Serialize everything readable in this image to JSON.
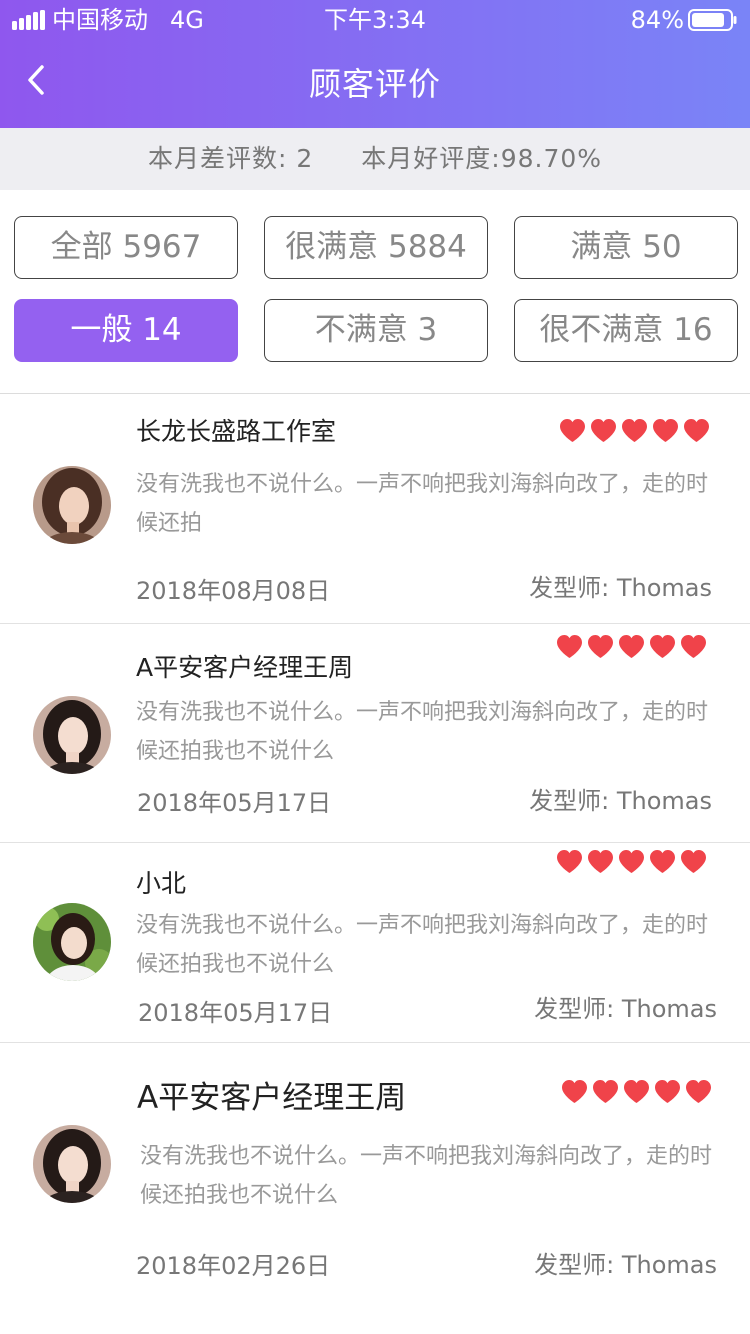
{
  "status_bar": {
    "carrier": "中国移动",
    "network": "4G",
    "time": "下午3:34",
    "battery": "84%",
    "signal_icon": "signal-bars-icon",
    "battery_icon": "battery-icon"
  },
  "nav": {
    "title": "顾客评价",
    "back_icon": "chevron-left-icon"
  },
  "summary": {
    "bad_reviews": "本月差评数: 2",
    "good_rate": "本月好评度:98.70%"
  },
  "filters": [
    {
      "label": "全部 5967",
      "active": false
    },
    {
      "label": "很满意 5884",
      "active": false
    },
    {
      "label": "满意 50",
      "active": false
    },
    {
      "label": "一般 14",
      "active": true
    },
    {
      "label": "不满意 3",
      "active": false
    },
    {
      "label": "很不满意 16",
      "active": false
    }
  ],
  "reviews": [
    {
      "name": "长龙长盛路工作室",
      "rating": 5,
      "text": "没有洗我也不说什么。一声不响把我刘海斜向改了，走的时候还拍",
      "date": "2018年08月08日",
      "stylist": "发型师: Thomas"
    },
    {
      "name": "A平安客户经理王周",
      "rating": 5,
      "text": "没有洗我也不说什么。一声不响把我刘海斜向改了，走的时候还拍我也不说什么",
      "date": "2018年05月17日",
      "stylist": "发型师: Thomas"
    },
    {
      "name": "小北",
      "rating": 5,
      "text": "没有洗我也不说什么。一声不响把我刘海斜向改了，走的时候还拍我也不说什么",
      "date": "2018年05月17日",
      "stylist": "发型师: Thomas"
    },
    {
      "name": "A平安客户经理王周",
      "rating": 5,
      "text": "没有洗我也不说什么。一声不响把我刘海斜向改了，走的时候还拍我也不说什么",
      "date": "2018年02月26日",
      "stylist": "发型师: Thomas"
    }
  ],
  "colors": {
    "header_gradient_start": "#8f57ee",
    "header_gradient_end": "#7a84f7",
    "active_filter": "#9461f0",
    "heart": "#f0434a",
    "summary_bg": "#eeeef2"
  }
}
